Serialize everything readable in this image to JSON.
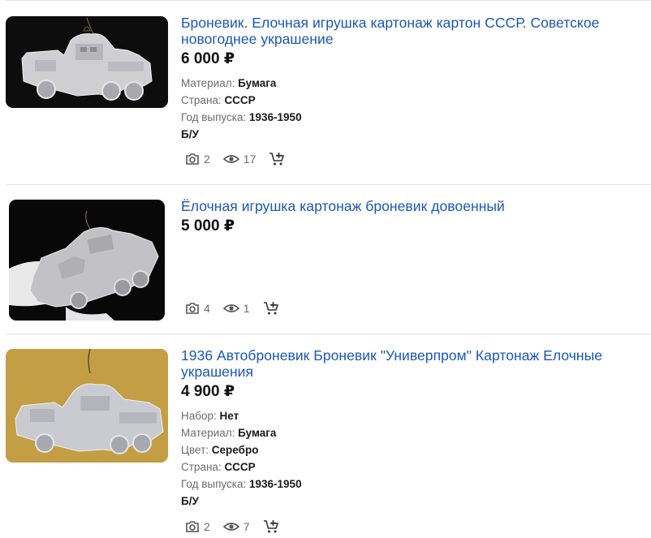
{
  "currency": "₽",
  "icons": {
    "photos": "camera-icon",
    "views": "eye-icon",
    "cart": "add-to-cart-icon"
  },
  "listings": [
    {
      "title": "Броневик. Елочная игрушка картонаж картон СССР. Советское новогоднее украшение",
      "price": "6 000 ₽",
      "attributes": [
        {
          "label": "Материал:",
          "value": "Бумага"
        },
        {
          "label": "Страна:",
          "value": "СССР"
        },
        {
          "label": "Год выпуска:",
          "value": "1936-1950"
        }
      ],
      "condition": "Б/У",
      "photos": "2",
      "views": "17"
    },
    {
      "title": "Ёлочная игрушка картонаж броневик довоенный",
      "price": "5 000 ₽",
      "attributes": [],
      "condition": "",
      "photos": "4",
      "views": "1"
    },
    {
      "title": "1936 Автоброневик Броневик \"Универпром\" Картонаж Елочные украшения",
      "price": "4 900 ₽",
      "attributes": [
        {
          "label": "Набор:",
          "value": "Нет"
        },
        {
          "label": "Материал:",
          "value": "Бумага"
        },
        {
          "label": "Цвет:",
          "value": "Серебро"
        },
        {
          "label": "Страна:",
          "value": "СССР"
        },
        {
          "label": "Год выпуска:",
          "value": "1936-1950"
        }
      ],
      "condition": "Б/У",
      "photos": "2",
      "views": "7"
    }
  ]
}
